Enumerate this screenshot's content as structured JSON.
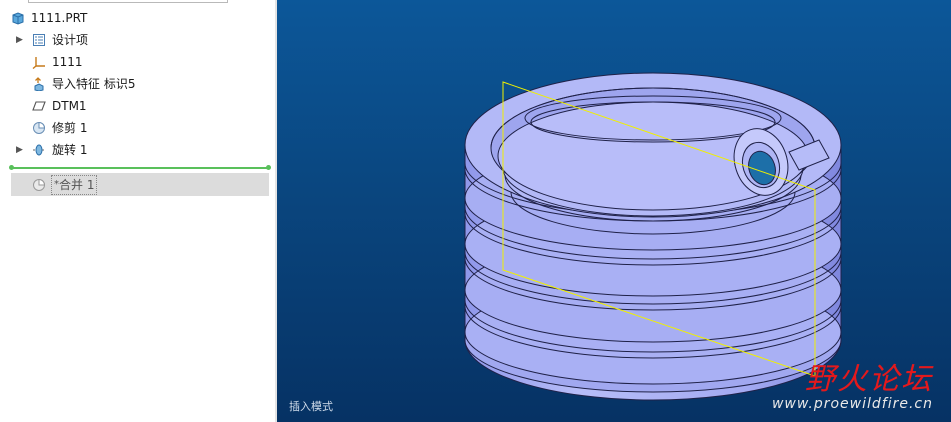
{
  "model_tree": {
    "part_name": "1111.PRT",
    "items": [
      {
        "label": "设计项",
        "expandable": true
      },
      {
        "label": "1111",
        "expandable": false
      },
      {
        "label": "导入特征 标识5",
        "expandable": false
      },
      {
        "label": "DTM1",
        "expandable": false
      },
      {
        "label": "修剪 1",
        "expandable": false
      },
      {
        "label": "旋转 1",
        "expandable": true
      }
    ],
    "after_insert": {
      "label": "合并 1",
      "prefix": "*"
    }
  },
  "viewport": {
    "status_text": "插入模式",
    "colors": {
      "background_top": "#0c5799",
      "background_bottom": "#063264",
      "model": "#a3aaf2",
      "datum_plane": "#f0f000",
      "insert_line": "#59c05b"
    }
  },
  "watermark": {
    "title": "野火论坛",
    "url": "www.proewildfire.cn"
  }
}
